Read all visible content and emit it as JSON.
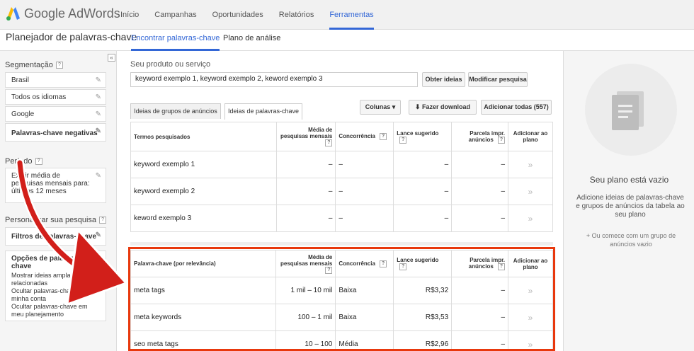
{
  "app": {
    "logo_google": "Google",
    "logo_product": "AdWords"
  },
  "nav": [
    {
      "label": "Início"
    },
    {
      "label": "Campanhas"
    },
    {
      "label": "Oportunidades"
    },
    {
      "label": "Relatórios"
    },
    {
      "label": "Ferramentas",
      "active": true
    }
  ],
  "subheader": {
    "title": "Planejador de palavras-chave",
    "tabs": [
      {
        "label": "Encontrar palavras-chave",
        "active": true
      },
      {
        "label": "Plano de análise"
      }
    ]
  },
  "sidebar": {
    "collapse_label": "«",
    "segmentation_label": "Segmentação",
    "targeting": [
      {
        "label": "Brasil"
      },
      {
        "label": "Todos os idiomas"
      },
      {
        "label": "Google"
      },
      {
        "label": "Palavras-chave negativas"
      }
    ],
    "period_label": "Período",
    "period_value": "Exibir média de pesquisas mensais para: últimos 12 meses",
    "customize_label": "Personalizar sua pesquisa",
    "filters_label": "Filtros de palavras-chave",
    "options_label": "Opções de palavras-chave",
    "options": [
      "Mostrar ideias amplamente relacionadas",
      "Ocultar palavras-chave em minha conta",
      "Ocultar palavras-chave em meu planejamento"
    ]
  },
  "search": {
    "label": "Seu produto ou serviço",
    "value": "keyword exemplo 1, keyword exemplo 2, keword exemplo 3",
    "get_ideas": "Obter ideias",
    "modify": "Modificar pesquisa"
  },
  "tabs": [
    {
      "label": "Ideias de grupos de anúncios"
    },
    {
      "label": "Ideias de palavras-chave",
      "active": true
    }
  ],
  "toolbar": {
    "columns": "Colunas ▾",
    "download": "Fazer download",
    "add_all": "Adicionar todas (557)"
  },
  "table_searched": {
    "headers": [
      "Termos pesquisados",
      "Média de pesquisas mensais",
      "Concorrência",
      "Lance sugerido",
      "Parcela impr. anúncios",
      "Adicionar ao plano"
    ],
    "rows": [
      [
        "keyword exemplo 1",
        "–",
        "–",
        "–",
        "–",
        "»"
      ],
      [
        "keyword exemplo 2",
        "–",
        "–",
        "–",
        "–",
        "»"
      ],
      [
        "keword exemplo 3",
        "–",
        "–",
        "–",
        "–",
        "»"
      ]
    ]
  },
  "table_ideas": {
    "headers": [
      "Palavra-chave (por relevância)",
      "Média de pesquisas mensais",
      "Concorrência",
      "Lance sugerido",
      "Parcela impr. anúncios",
      "Adicionar ao plano"
    ],
    "rows": [
      [
        "meta tags",
        "1 mil – 10 mil",
        "Baixa",
        "R$3,32",
        "–",
        "»"
      ],
      [
        "meta keywords",
        "100 – 1 mil",
        "Baixa",
        "R$3,53",
        "–",
        "»"
      ],
      [
        "seo meta tags",
        "10 – 100",
        "Média",
        "R$2,96",
        "–",
        "»"
      ]
    ]
  },
  "plan": {
    "title": "Seu plano está vazio",
    "text": "Adicione ideias de palavras-chave e grupos de anúncios da tabela ao seu plano",
    "sub": "+ Ou comece com um grupo de anúncios vazio"
  },
  "colors": {
    "accent": "#3367d6",
    "highlight": "#e8380d",
    "arrow": "#d21f1a"
  }
}
